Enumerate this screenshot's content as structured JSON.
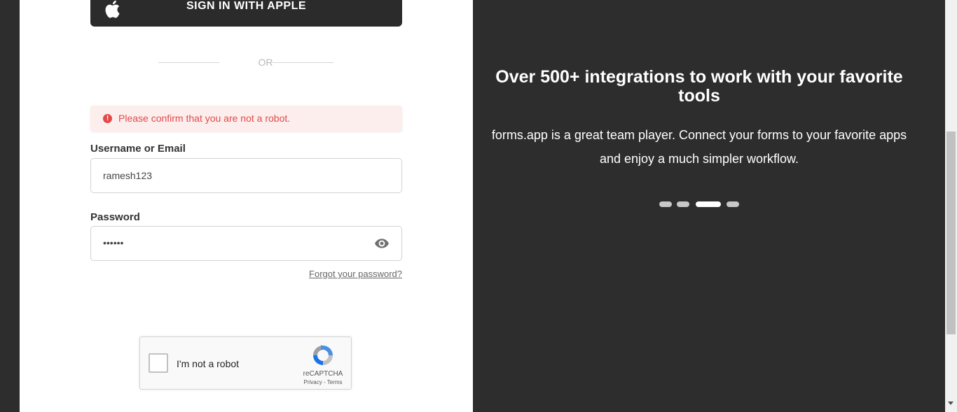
{
  "login": {
    "apple_label": "SIGN IN WITH APPLE",
    "or_text": "OR",
    "alert_text": "Please confirm that you are not a robot.",
    "username_label": "Username or Email",
    "username_value": "ramesh123",
    "password_label": "Password",
    "password_value": "••••••",
    "forgot_link": "Forgot your password?"
  },
  "recaptcha": {
    "label": "I'm not a robot",
    "brand": "reCAPTCHA",
    "links": "Privacy - Terms"
  },
  "promo": {
    "headline": "Over 500+ integrations to work with your favorite tools",
    "subtext": "forms.app is a great team player. Connect your forms to your favorite apps and enjoy a much simpler workflow.",
    "slides_total": 4,
    "active_slide": 3
  },
  "colors": {
    "dark_bg": "#2d2d2d",
    "error": "#e34949",
    "alert_bg": "#fdeeee"
  }
}
